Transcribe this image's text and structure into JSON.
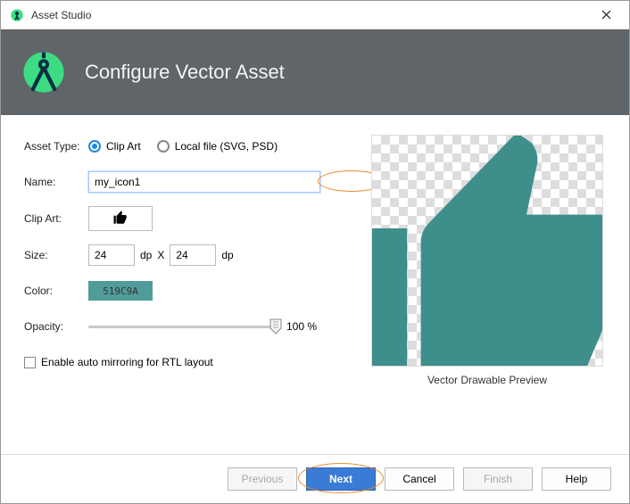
{
  "window": {
    "title": "Asset Studio"
  },
  "header": {
    "title": "Configure Vector Asset"
  },
  "form": {
    "asset_type_label": "Asset Type:",
    "asset_type_options": {
      "clip_art": "Clip Art",
      "local_file": "Local file (SVG, PSD)"
    },
    "asset_type_selected": "clip_art",
    "name_label": "Name:",
    "name_value": "my_icon1",
    "clipart_label": "Clip Art:",
    "size_label": "Size:",
    "size_w": "24",
    "size_h": "24",
    "size_unit": "dp",
    "size_sep": "X",
    "color_label": "Color:",
    "color_hex": "519C9A",
    "opacity_label": "Opacity:",
    "opacity_value": 100,
    "opacity_text": "100 %",
    "rtl_label": "Enable auto mirroring for RTL layout",
    "rtl_checked": false
  },
  "preview": {
    "caption": "Vector Drawable Preview",
    "fill": "#3E8E8B"
  },
  "footer": {
    "previous": "Previous",
    "next": "Next",
    "cancel": "Cancel",
    "finish": "Finish",
    "help": "Help"
  },
  "icons": {
    "app": "android-studio",
    "thumb": "thumb-up"
  }
}
